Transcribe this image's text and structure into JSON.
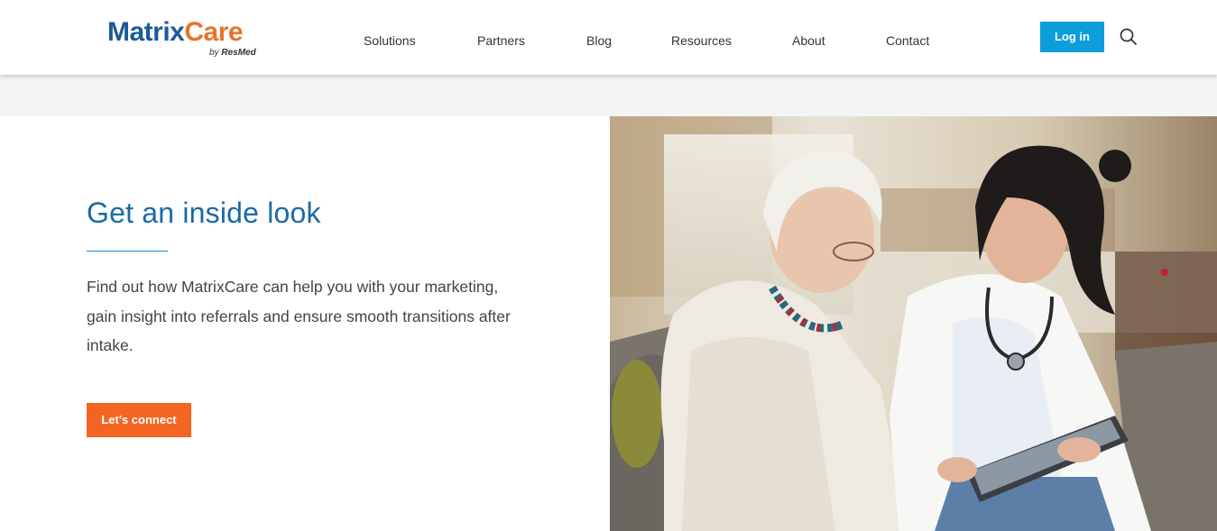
{
  "header": {
    "logo": {
      "brand_main": "Matrix",
      "brand_accent": "Care",
      "sub_prefix": "by ",
      "sub_brand": "ResMed"
    },
    "nav": [
      {
        "label": "Solutions"
      },
      {
        "label": "Partners"
      },
      {
        "label": "Blog"
      },
      {
        "label": "Resources"
      },
      {
        "label": "About"
      },
      {
        "label": "Contact"
      }
    ],
    "login_label": "Log in",
    "search_icon": "search-icon"
  },
  "hero": {
    "headline": "Get an inside look",
    "body": "Find out how MatrixCare can help you with your marketing, gain insight into referrals and ensure smooth transitions after intake.",
    "cta_label": "Let's connect"
  },
  "colors": {
    "brand_blue": "#1c5a96",
    "brand_orange": "#e9732a",
    "login_blue": "#0d9ddb",
    "cta_orange": "#f26522",
    "headline_blue": "#1a6aa6"
  }
}
